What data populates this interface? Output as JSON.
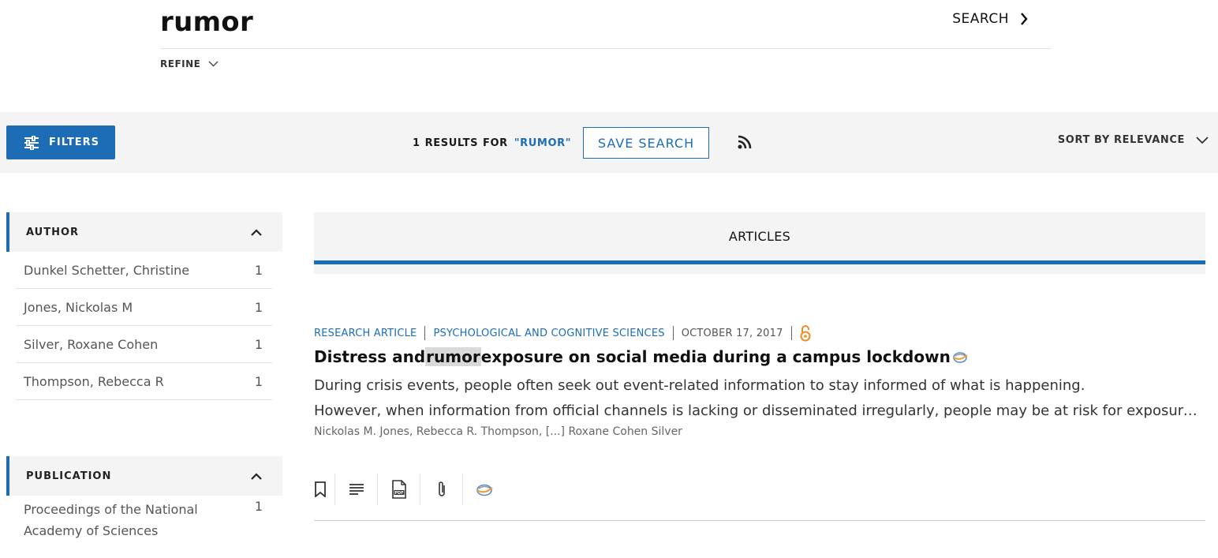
{
  "search": {
    "query": "rumor",
    "button_label": "SEARCH",
    "refine_label": "REFINE"
  },
  "toolbar": {
    "filters_label": "FILTERS",
    "results_count": "1",
    "results_label": "RESULTS",
    "for_label": "FOR",
    "query_display": "\"RUMOR\"",
    "save_search_label": "SAVE SEARCH",
    "sort_label": "SORT BY RELEVANCE"
  },
  "facets": {
    "author": {
      "title": "AUTHOR",
      "items": [
        {
          "name": "Dunkel Schetter, Christine",
          "count": "1"
        },
        {
          "name": "Jones, Nickolas M",
          "count": "1"
        },
        {
          "name": "Silver, Roxane Cohen",
          "count": "1"
        },
        {
          "name": "Thompson, Rebecca R",
          "count": "1"
        }
      ]
    },
    "publication": {
      "title": "PUBLICATION",
      "items": [
        {
          "name": "Proceedings of the National Academy of Sciences",
          "count": "1"
        }
      ]
    }
  },
  "tabs": {
    "articles_label": "ARTICLES"
  },
  "result": {
    "type": "RESEARCH ARTICLE",
    "section": "PSYCHOLOGICAL AND COGNITIVE SCIENCES",
    "date": "OCTOBER 17, 2017",
    "title_before": "Distress and ",
    "title_highlight": "rumor",
    "title_after": " exposure on social media during a campus lockdown",
    "abstract_line1": "During crisis events, people often seek out event-related information to stay informed of what is happening.",
    "abstract_line2": "However, when information from official channels is lacking or disseminated irregularly, people may be at risk for exposure to rumors.",
    "authors": "Nickolas M. Jones, Rebecca R. Thompson, [...] Roxane Cohen Silver"
  },
  "colors": {
    "accent": "#1d6db6",
    "open_access": "#f08c1e",
    "band": "#f4f4f4"
  },
  "icons": {
    "search_arrow": "chevron-right-icon",
    "refine": "chevron-down-icon",
    "filters": "sliders-icon",
    "rss": "rss-icon",
    "sort": "chevron-down-icon",
    "facet_toggle": "chevron-up-icon",
    "open_access": "open-access-lock-icon",
    "altmetric": "altmetric-icon",
    "actions": [
      "bookmark-icon",
      "abstract-icon",
      "pdf-icon",
      "attachment-icon",
      "altmetric-icon"
    ]
  }
}
